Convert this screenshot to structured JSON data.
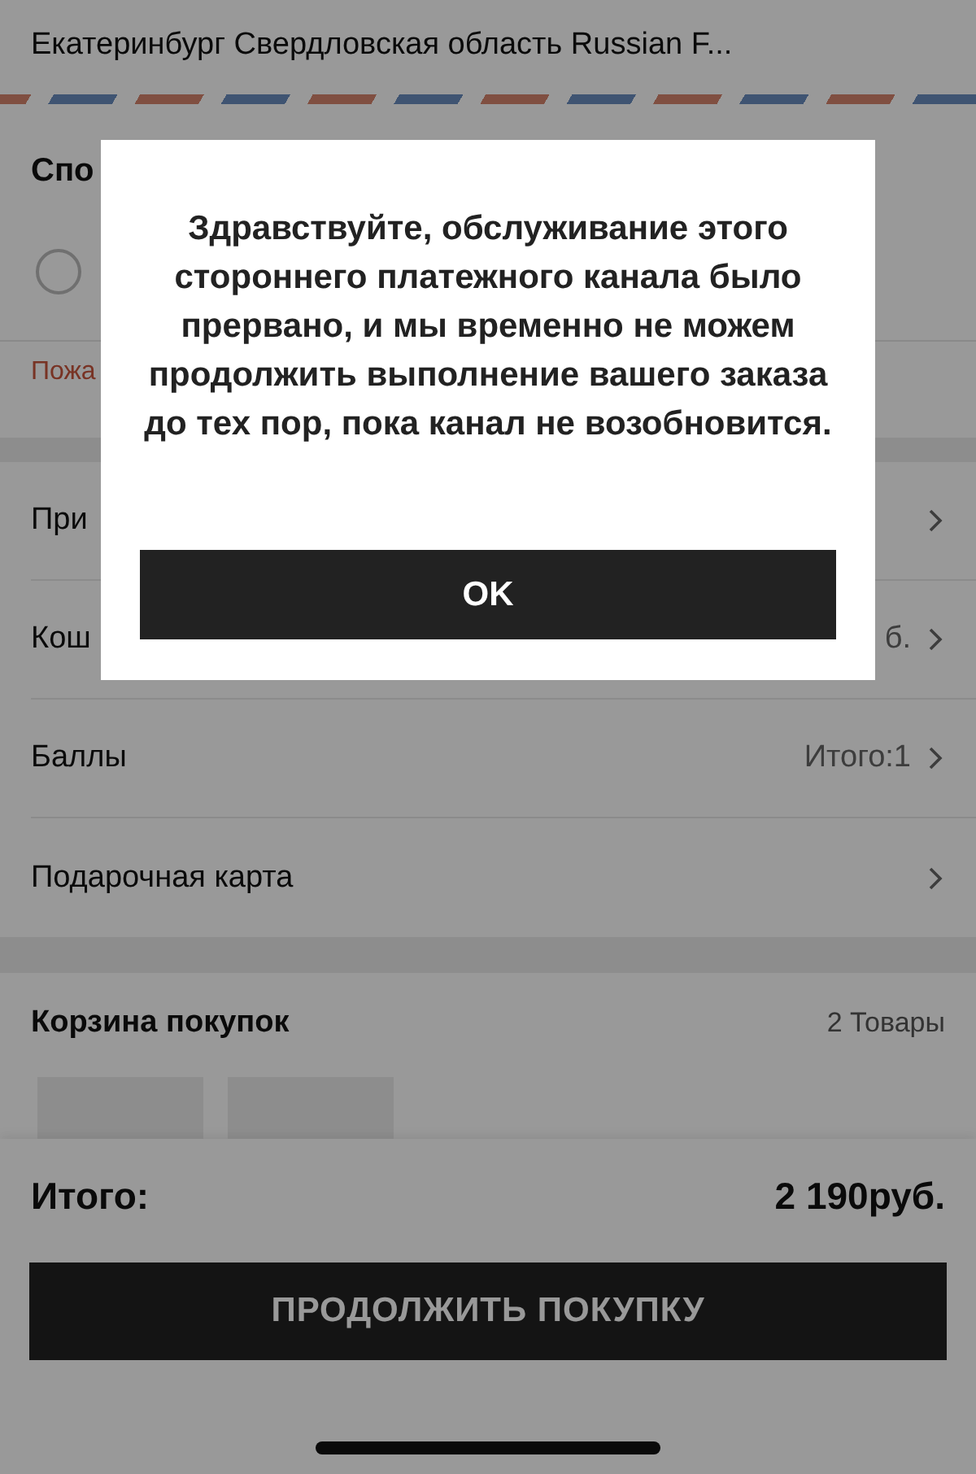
{
  "address": {
    "line": "Екатеринбург Свердловская область Russian F..."
  },
  "payment": {
    "title": "Спо",
    "options": [
      {
        "selected": false
      }
    ],
    "notice": "Пожа"
  },
  "rows": [
    {
      "label": "При"
    },
    {
      "label": "Кош",
      "value": "б."
    },
    {
      "label": "Баллы",
      "value": "Итого:1"
    },
    {
      "label": "Подарочная карта"
    }
  ],
  "cart": {
    "title": "Корзина покупок",
    "count": "2 Товары"
  },
  "footer": {
    "total_label": "Итого:",
    "total": "2 190руб.",
    "button": "ПРОДОЛЖИТЬ ПОКУПКУ"
  },
  "dialog": {
    "message": "Здравствуйте, обслуживание этого стороннего платежного канала было прервано, и мы временно не можем продолжить выполнение вашего заказа до тех пор, пока канал не возобновится.",
    "button": "OK"
  }
}
